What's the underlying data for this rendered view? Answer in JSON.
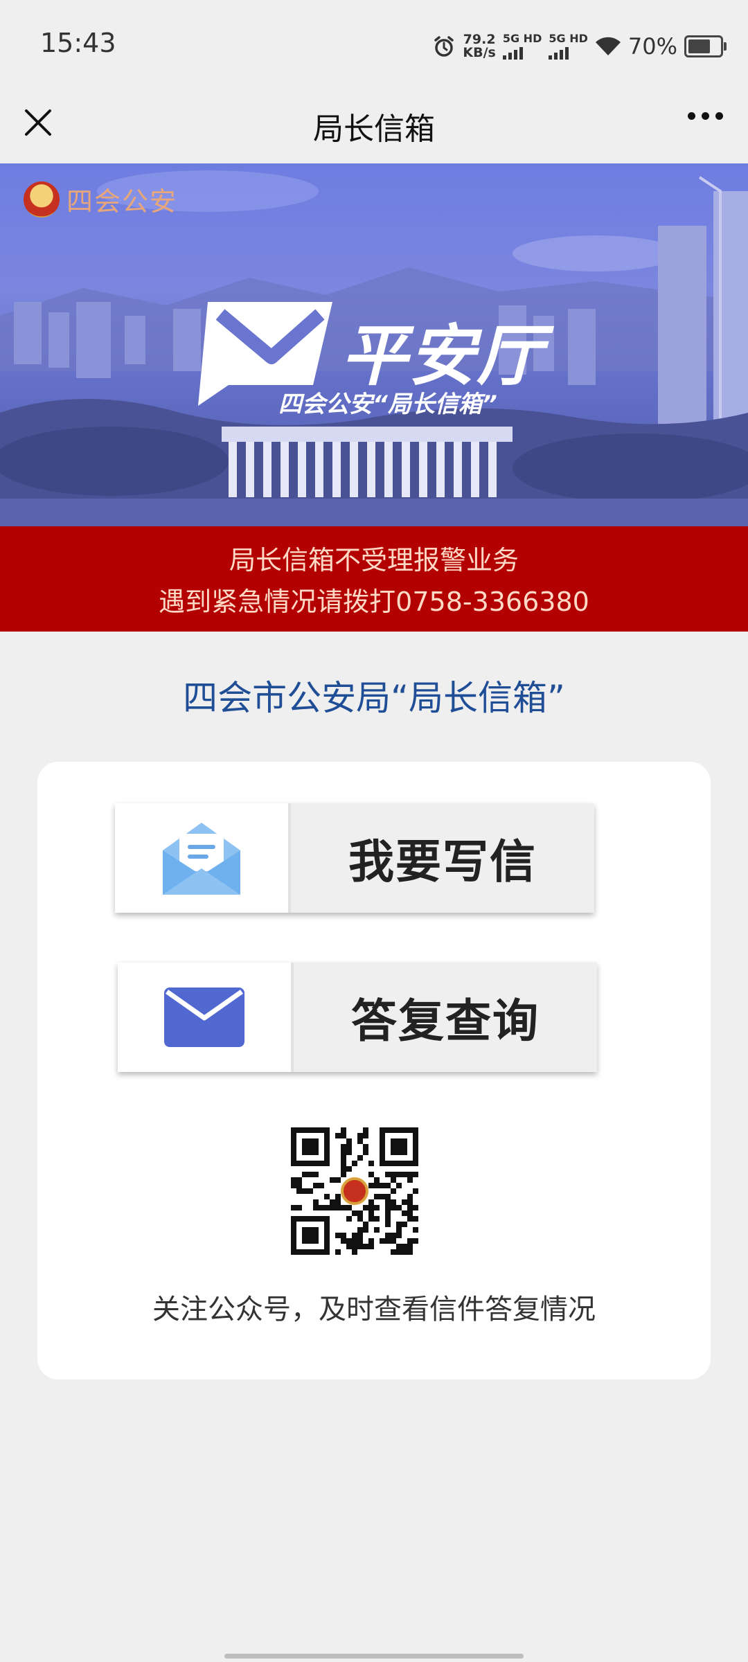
{
  "status_bar": {
    "time": "15:43",
    "net_speed_value": "79.2",
    "net_speed_unit": "KB/s",
    "sim1_label": "5G HD",
    "sim2_label": "5G HD",
    "battery_text": "70%",
    "battery_level": 0.7,
    "icons": [
      "alarm-icon",
      "signal-icon",
      "wifi-icon",
      "battery-icon"
    ]
  },
  "nav": {
    "title": "局长信箱",
    "close_icon": "close-icon",
    "more_icon": "more-icon"
  },
  "banner": {
    "org_name": "四会公安",
    "logo_word": "平安厅",
    "logo_subtitle": "四会公安“局长信箱”"
  },
  "notice": {
    "line1": "局长信箱不受理报警业务",
    "line2": "遇到紧急情况请拨打0758-3366380",
    "bg_color": "#b30000"
  },
  "section_title": "四会市公安局“局长信箱”",
  "actions": {
    "write_label": "我要写信",
    "query_label": "答复查询"
  },
  "qr": {
    "caption": "关注公众号，及时查看信件答复情况"
  },
  "colors": {
    "accent_blue": "#1f4e97",
    "envelope_light": "#7fb8ee",
    "envelope_dark": "#5068d0"
  }
}
